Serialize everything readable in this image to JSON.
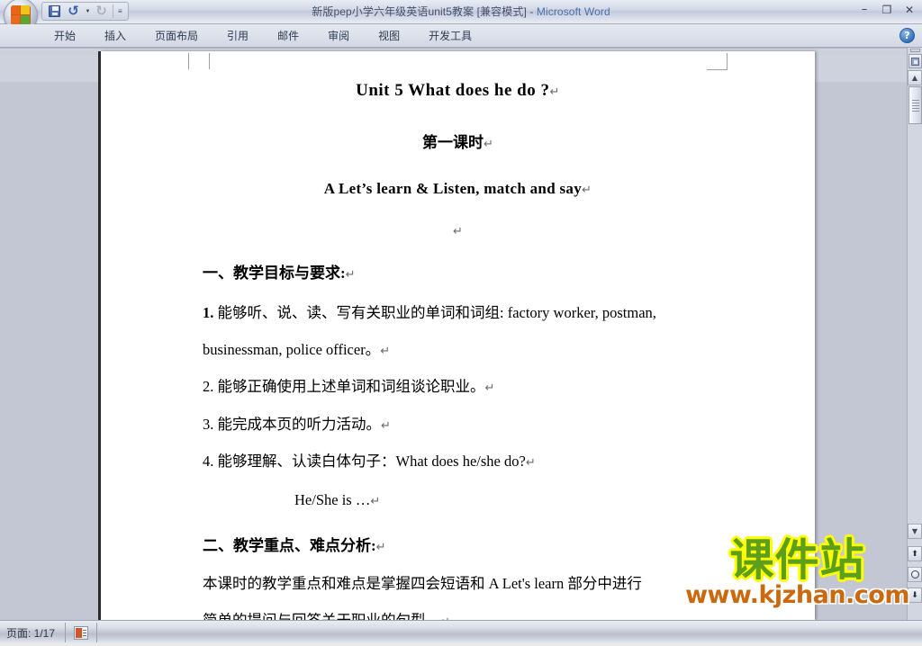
{
  "window": {
    "title": "新版pep小学六年级英语unit5教案 [兼容模式]",
    "separator": " - ",
    "app_name": "Microsoft Word",
    "minimize_glyph": "–",
    "restore_glyph": "❐",
    "close_glyph": "✕"
  },
  "quick_access": {
    "save_label": "",
    "undo_glyph": "↺",
    "redo_glyph": "↻",
    "dropdown_glyph": "▼",
    "customize_glyph": "≡"
  },
  "ribbon": {
    "tabs": [
      {
        "label": "开始"
      },
      {
        "label": "插入"
      },
      {
        "label": "页面布局"
      },
      {
        "label": "引用"
      },
      {
        "label": "邮件"
      },
      {
        "label": "审阅"
      },
      {
        "label": "视图"
      },
      {
        "label": "开发工具"
      }
    ],
    "help_glyph": "?"
  },
  "document": {
    "title": "Unit 5    What does he do ?",
    "subtitle": "第一课时",
    "subheading": "A Let’s    learn    &    Listen, match and say",
    "blank_line": "",
    "section1_heading": "一、教学目标与要求:",
    "item1_num": "1.",
    "item1_text": " 能够听、说、读、写有关职业的单词和词组: factory worker, postman,",
    "item1_cont": "businessman, police officer。",
    "item2": "2. 能够正确使用上述单词和词组谈论职业。",
    "item3": "3. 能完成本页的听力活动。",
    "item4": "4. 能够理解、认读白体句子：What does he/she do?",
    "item4_cont": "He/She is  …",
    "section2_heading": "二、教学重点、难点分析:",
    "section2_line1": "本课时的教学重点和难点是掌握四会短语和 A Let's learn 部分中进行",
    "section2_line2": "简单的提问与回答关于职业的句型。",
    "pilcrow": "↵"
  },
  "watermark": {
    "chinese_text": "课件站",
    "url_text": "www.kjzhan.com",
    "text_color": "#5d9e1b",
    "outline_color": "#ffff00",
    "url_color": "#c96a10"
  },
  "scrollbar": {
    "split_label": "",
    "select_browse_glyph": "",
    "up_glyph": "▲",
    "down_glyph": "▼",
    "prev_page_glyph": "⬆",
    "next_page_glyph": "⬇",
    "browse_circle_glyph": ""
  },
  "statusbar": {
    "page_label": "页面: 1/17",
    "view_icon": "page-view-icon"
  }
}
